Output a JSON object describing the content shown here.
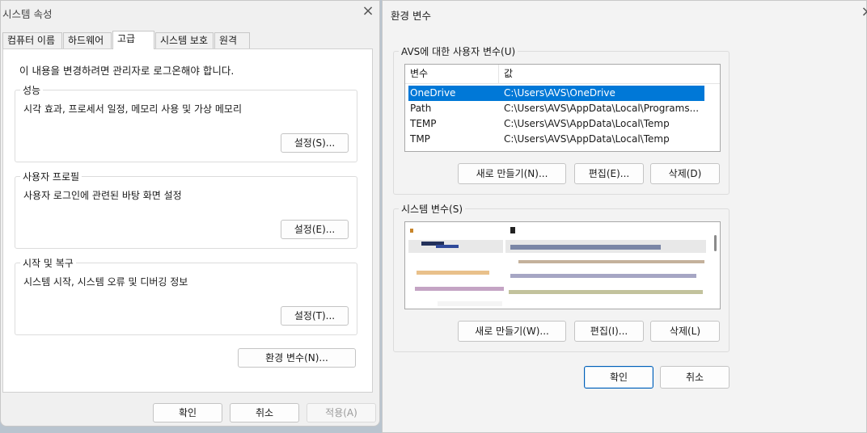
{
  "system_properties": {
    "title": "시스템 속성",
    "tabs": [
      {
        "label": "컴퓨터 이름"
      },
      {
        "label": "하드웨어"
      },
      {
        "label": "고급"
      },
      {
        "label": "시스템 보호"
      },
      {
        "label": "원격"
      }
    ],
    "active_tab": "고급",
    "admin_notice": "이 내용을 변경하려면 관리자로 로그온해야 합니다.",
    "performance": {
      "label": "성능",
      "description": "시각 효과, 프로세서 일정, 메모리 사용 및 가상 메모리",
      "button": "설정(S)..."
    },
    "user_profiles": {
      "label": "사용자 프로필",
      "description": "사용자 로그인에 관련된 바탕 화면 설정",
      "button": "설정(E)..."
    },
    "startup_recovery": {
      "label": "시작 및 복구",
      "description": "시스템 시작, 시스템 오류 및 디버깅 정보",
      "button": "설정(T)..."
    },
    "env_vars_button": "환경 변수(N)...",
    "ok": "확인",
    "cancel": "취소",
    "apply": "적용(A)"
  },
  "environment_variables": {
    "title": "환경 변수",
    "user_vars": {
      "label": "AVS에 대한 사용자 변수(U)",
      "columns": [
        "변수",
        "값"
      ],
      "rows": [
        {
          "name": "OneDrive",
          "value": "C:\\Users\\AVS\\OneDrive",
          "selected": true
        },
        {
          "name": "Path",
          "value": "C:\\Users\\AVS\\AppData\\Local\\Programs..."
        },
        {
          "name": "TEMP",
          "value": "C:\\Users\\AVS\\AppData\\Local\\Temp"
        },
        {
          "name": "TMP",
          "value": "C:\\Users\\AVS\\AppData\\Local\\Temp"
        }
      ],
      "new_button": "새로 만들기(N)...",
      "edit_button": "편집(E)...",
      "delete_button": "삭제(D)"
    },
    "system_vars": {
      "label": "시스템 변수(S)",
      "new_button": "새로 만들기(W)...",
      "edit_button": "편집(I)...",
      "delete_button": "삭제(L)"
    },
    "ok": "확인",
    "cancel": "취소"
  },
  "colors": {
    "selection": "#0078d7",
    "primary_border": "#005fb8"
  }
}
